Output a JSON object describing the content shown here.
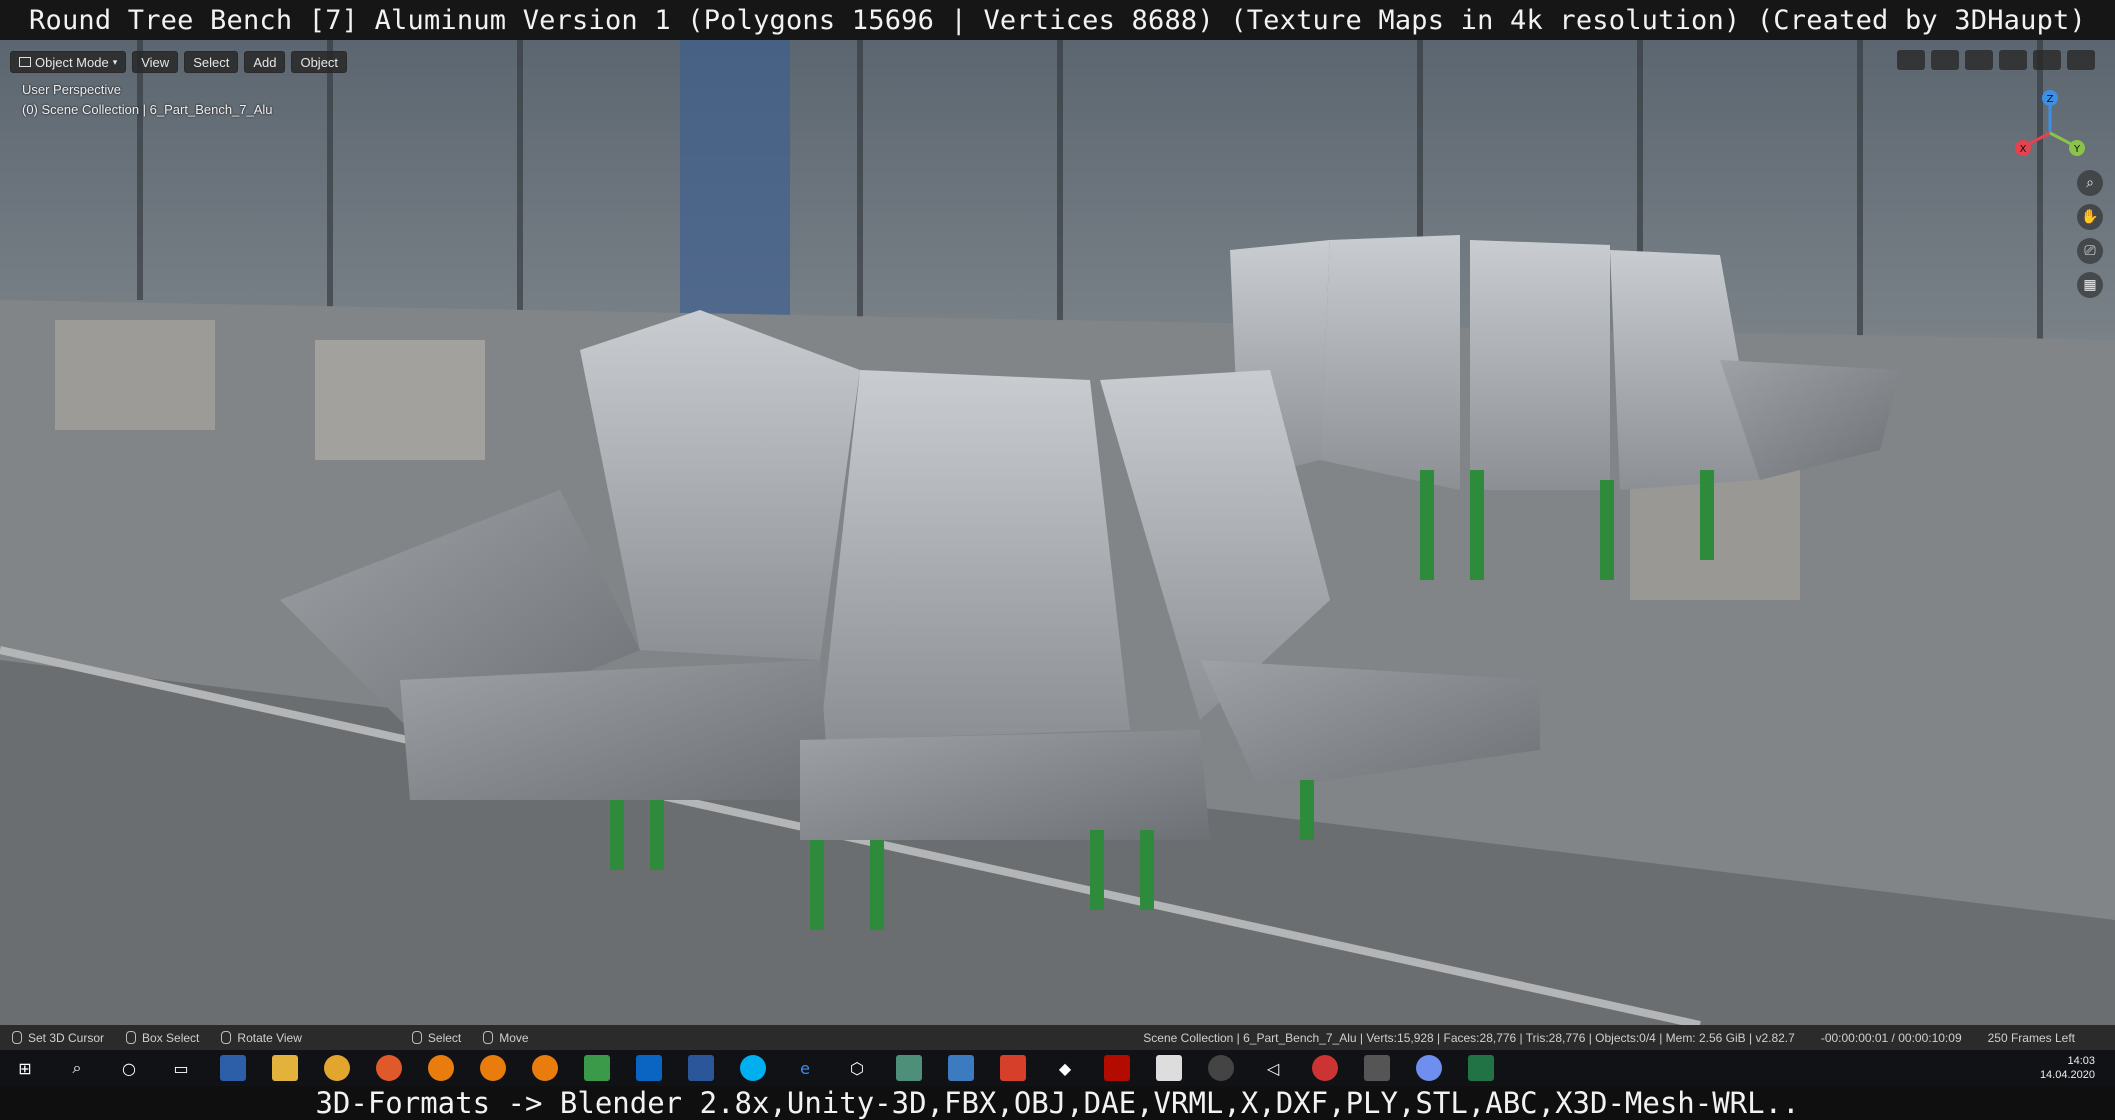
{
  "title": "Round Tree Bench [7] Aluminum Version 1 (Polygons 15696 | Vertices 8688) (Texture Maps in 4k resolution) (Created by 3DHaupt)",
  "viewport": {
    "mode_label": "Object Mode",
    "menu": [
      "View",
      "Select",
      "Add",
      "Object"
    ],
    "perspective_label": "User Perspective",
    "collection_label": "(0) Scene Collection | 6_Part_Bench_7_Alu",
    "gizmo_axes": {
      "x": "X",
      "y": "Y",
      "z": "Z"
    },
    "colors": {
      "x_axis": "#e4424d",
      "y_axis": "#8bc34a",
      "z_axis": "#3d8fe6"
    }
  },
  "status_bar": {
    "items": [
      {
        "label": "Set 3D Cursor",
        "icon": "mouse-left-icon"
      },
      {
        "label": "Box Select",
        "icon": "mouse-box-icon"
      },
      {
        "label": "Rotate View",
        "icon": "mouse-middle-icon"
      },
      {
        "label": "Select",
        "icon": "mouse-left-icon"
      },
      {
        "label": "Move",
        "icon": "mouse-drag-icon"
      }
    ],
    "scene_info": "Scene Collection | 6_Part_Bench_7_Alu | Verts:15,928 | Faces:28,776 | Tris:28,776 | Objects:0/4 | Mem: 2.56 GiB | v2.82.7",
    "timecode": "-00:00:00:01 / 00:00:10:09",
    "frames_left": "250 Frames Left"
  },
  "taskbar": {
    "icons": [
      "windows-icon",
      "search-icon",
      "cortana-icon",
      "task-view-icon",
      "save-icon",
      "folder-icon",
      "chrome-icon",
      "firefox-icon",
      "blender-icon",
      "blender-icon-2",
      "blender-icon-3",
      "notepad-icon",
      "outlook-icon",
      "word-icon",
      "skype-icon",
      "edge-icon",
      "cube-icon",
      "tool-icon",
      "draw-icon",
      "brave-icon",
      "sketchup-icon",
      "acrobat-icon",
      "unity-icon",
      "obs-icon",
      "unreal-icon",
      "paint-icon",
      "calculator-icon",
      "maps-icon",
      "excel-icon"
    ],
    "time": "14:03",
    "date": "14.04.2020"
  },
  "caption": "3D-Formats -> Blender 2.8x,Unity-3D,FBX,OBJ,DAE,VRML,X,DXF,PLY,STL,ABC,X3D-Mesh-WRL.."
}
